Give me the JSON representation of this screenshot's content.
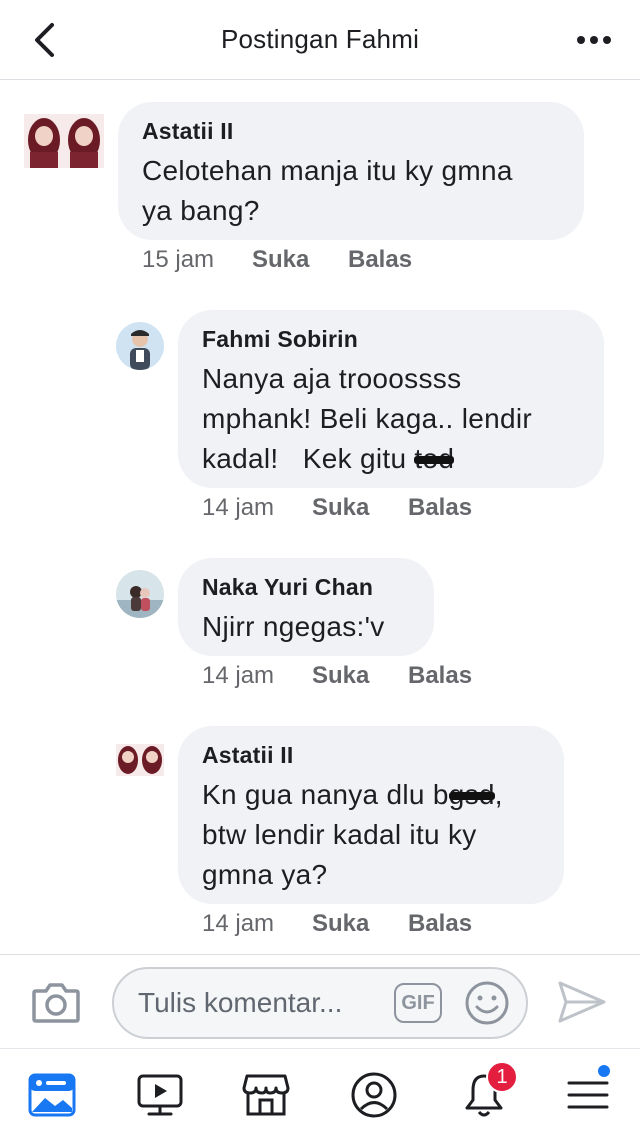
{
  "header": {
    "title": "Postingan Fahmi",
    "back_icon": "chevron-left-icon",
    "more_icon": "ellipsis-icon"
  },
  "comments": [
    {
      "author": "Astatii II",
      "lines": [
        "Celotehan manja itu ky gmna",
        "ya bang?"
      ],
      "time": "15 jam",
      "like": "Suka",
      "reply": "Balas"
    },
    {
      "author": "Fahmi Sobirin",
      "line1": "Nanya aja trooossss",
      "line2": "mphank! Beli kaga..  lendir",
      "line3_prefix": "kadal!   Kek gitu ",
      "line3_redacted": "tod",
      "time": "14 jam",
      "like": "Suka",
      "reply": "Balas"
    },
    {
      "author": "Naka Yuri Chan",
      "lines": [
        "Njirr ngegas:'v"
      ],
      "time": "14 jam",
      "like": "Suka",
      "reply": "Balas"
    },
    {
      "author": "Astatii II",
      "line1_prefix": "Kn gua nanya dlu b",
      "line1_redacted": "gsd",
      "line1_suffix": ",",
      "line2": "btw lendir kadal itu ky",
      "line3": "gmna ya?",
      "time": "14 jam",
      "like": "Suka",
      "reply": "Balas"
    }
  ],
  "composer": {
    "placeholder": "Tulis komentar...",
    "gif_label": "GIF"
  },
  "nav": {
    "notifications_badge": "1"
  },
  "colors": {
    "bubble": "#f0f2f5",
    "meta": "#65676b",
    "accent": "#1877f2",
    "badge": "#e41e3f"
  }
}
